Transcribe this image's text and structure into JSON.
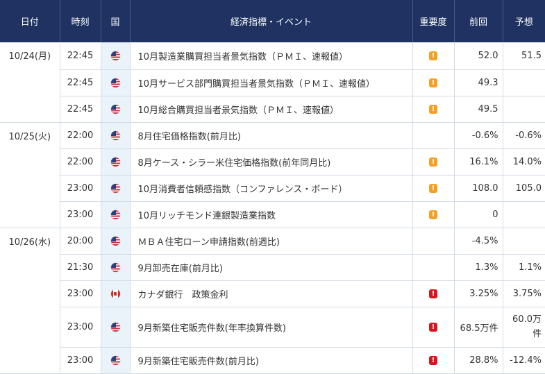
{
  "headers": {
    "date": "日付",
    "time": "時刻",
    "country": "国",
    "event": "経済指標・イベント",
    "importance": "重要度",
    "previous": "前回",
    "forecast": "予想"
  },
  "colors": {
    "header_bg": "#1f3261",
    "flag_col_bg": "#eaf2fa",
    "importance_mid": "#f5a020",
    "importance_high": "#d9141e"
  },
  "rows": [
    {
      "date": "10/24(月)",
      "time": "22:45",
      "country": "us-flag-icon",
      "event": "10月製造業購買担当者景気指数（ＰＭＩ、速報値）",
      "importance": "mid",
      "importance_mark": "!",
      "previous": "52.0",
      "forecast": "51.5"
    },
    {
      "date": "",
      "time": "22:45",
      "country": "us-flag-icon",
      "event": "10月サービス部門購買担当者景気指数（ＰＭＩ、速報値）",
      "importance": "mid",
      "importance_mark": "!",
      "previous": "49.3",
      "forecast": ""
    },
    {
      "date": "",
      "time": "22:45",
      "country": "us-flag-icon",
      "event": "10月総合購買担当者景気指数（ＰＭＩ、速報値）",
      "importance": "mid",
      "importance_mark": "!",
      "previous": "49.5",
      "forecast": ""
    },
    {
      "date": "10/25(火)",
      "time": "22:00",
      "country": "us-flag-icon",
      "event": "8月住宅価格指数(前月比)",
      "importance": "",
      "importance_mark": "",
      "previous": "-0.6%",
      "forecast": "-0.6%"
    },
    {
      "date": "",
      "time": "22:00",
      "country": "us-flag-icon",
      "event": "8月ケース・シラー米住宅価格指数(前年同月比)",
      "importance": "mid",
      "importance_mark": "!",
      "previous": "16.1%",
      "forecast": "14.0%"
    },
    {
      "date": "",
      "time": "23:00",
      "country": "us-flag-icon",
      "event": "10月消費者信頼感指数（コンファレンス・ボード）",
      "importance": "mid",
      "importance_mark": "!",
      "previous": "108.0",
      "forecast": "105.0"
    },
    {
      "date": "",
      "time": "23:00",
      "country": "us-flag-icon",
      "event": "10月リッチモンド連銀製造業指数",
      "importance": "mid",
      "importance_mark": "!",
      "previous": "0",
      "forecast": ""
    },
    {
      "date": "10/26(水)",
      "time": "20:00",
      "country": "us-flag-icon",
      "event": "ＭＢＡ住宅ローン申請指数(前週比)",
      "importance": "",
      "importance_mark": "",
      "previous": "-4.5%",
      "forecast": ""
    },
    {
      "date": "",
      "time": "21:30",
      "country": "us-flag-icon",
      "event": "9月卸売在庫(前月比)",
      "importance": "",
      "importance_mark": "",
      "previous": "1.3%",
      "forecast": "1.1%"
    },
    {
      "date": "",
      "time": "23:00",
      "country": "ca-flag-icon",
      "event": "カナダ銀行　政策金利",
      "importance": "high",
      "importance_mark": "!",
      "previous": "3.25%",
      "forecast": "3.75%"
    },
    {
      "date": "",
      "time": "23:00",
      "country": "us-flag-icon",
      "event": "9月新築住宅販売件数(年率換算件数)",
      "importance": "high",
      "importance_mark": "!",
      "previous": "68.5万件",
      "forecast": "60.0万件"
    },
    {
      "date": "",
      "time": "23:00",
      "country": "us-flag-icon",
      "event": "9月新築住宅販売件数(前月比)",
      "importance": "high",
      "importance_mark": "!",
      "previous": "28.8%",
      "forecast": "-12.4%"
    }
  ]
}
